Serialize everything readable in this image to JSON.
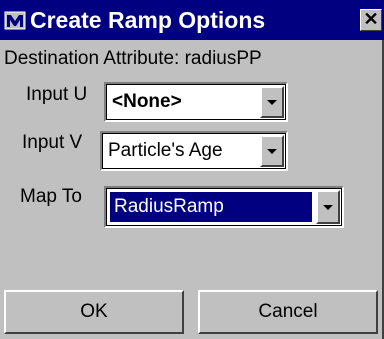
{
  "window": {
    "title": "Create Ramp Options",
    "close_glyph": "✕"
  },
  "destination": {
    "text": "Destination Attribute: radiusPP"
  },
  "fields": [
    {
      "label": "Input U",
      "value": "<None>"
    },
    {
      "label": "Input V",
      "value": "Particle's Age"
    },
    {
      "label": "Map To",
      "value": "RadiusRamp"
    }
  ],
  "buttons": {
    "ok": "OK",
    "cancel": "Cancel"
  },
  "colors": {
    "titlebar": "#000080",
    "dialog": "#c0c0c0",
    "selection": "#000080"
  }
}
